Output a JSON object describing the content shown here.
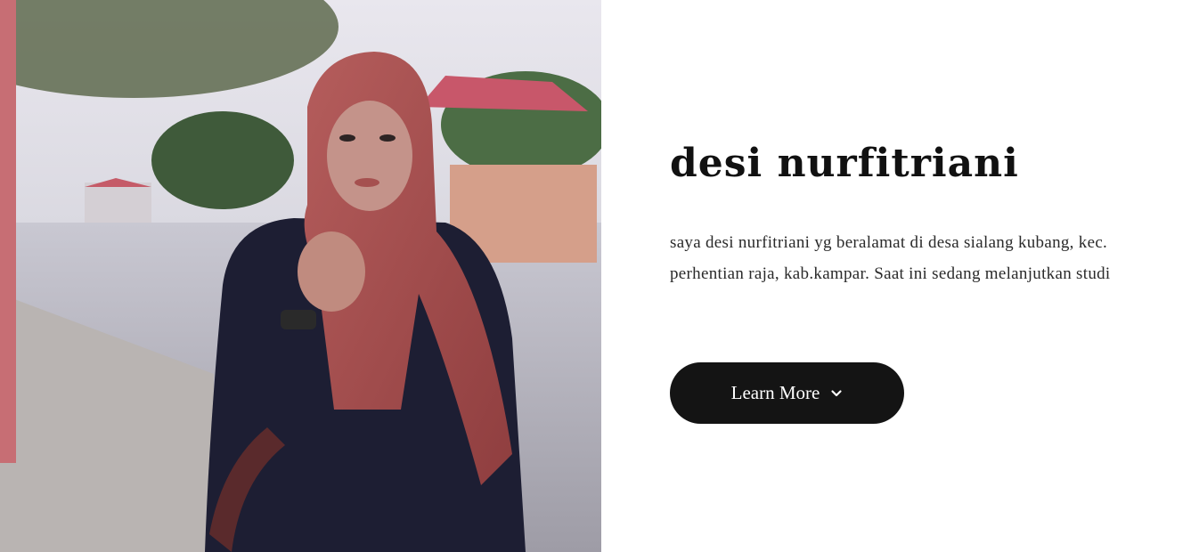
{
  "hero": {
    "photo_icon": "portrait-photo",
    "title": "desi nurfitriani",
    "description": "saya desi nurfitriani yg beralamat di desa sialang kubang, kec. perhentian raja, kab.kampar. Saat ini sedang melanjutkan studi",
    "cta_label": "Learn More",
    "cta_icon": "chevron-down-icon"
  },
  "colors": {
    "background": "#ffffff",
    "title": "#111111",
    "text": "#2a2a2a",
    "button": "#141414",
    "button_text": "#ffffff"
  }
}
